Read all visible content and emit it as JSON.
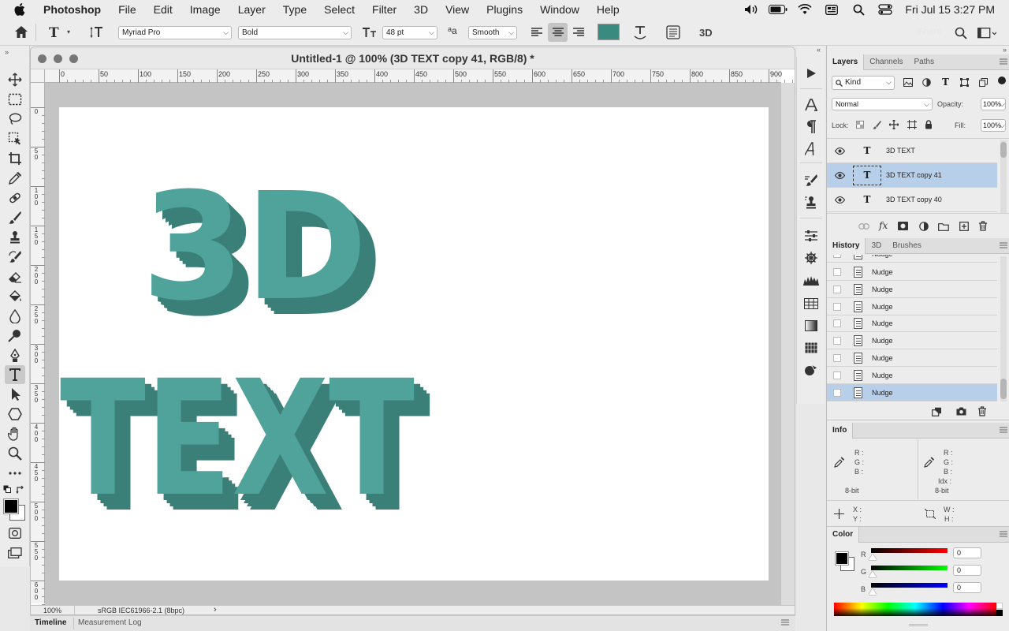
{
  "menubar": {
    "app": "Photoshop",
    "items": [
      "File",
      "Edit",
      "Image",
      "Layer",
      "Type",
      "Select",
      "Filter",
      "3D",
      "View",
      "Plugins",
      "Window",
      "Help"
    ],
    "clock": "Fri Jul 15  3:27 PM"
  },
  "options": {
    "font_family": "Myriad Pro",
    "font_style": "Bold",
    "font_size": "48 pt",
    "aa_label": "a",
    "antialias": "Smooth",
    "color_swatch": "#3b8a80",
    "mode_3d": "3D",
    "share_label": "Share"
  },
  "document": {
    "title": "Untitled-1 @ 100% (3D TEXT copy 41, RGB/8) *",
    "zoom": "100%",
    "profile": "sRGB IEC61966-2.1 (8bpc)",
    "ruler_labels": [
      "0",
      "50",
      "100",
      "150",
      "200",
      "250",
      "300",
      "350",
      "400",
      "450",
      "500",
      "550",
      "600",
      "650",
      "700",
      "750",
      "800",
      "850",
      "900"
    ],
    "vruler_labels": [
      "0",
      "50",
      "100",
      "150",
      "200",
      "250",
      "300",
      "350",
      "400",
      "450",
      "500",
      "550",
      "600"
    ],
    "canvas_line1": "3D",
    "canvas_line2": "TEXT",
    "text_face_color": "#4fa39a",
    "text_side_color": "#3a8078"
  },
  "bottom_tabs": [
    "Timeline",
    "Measurement Log"
  ],
  "layers_panel": {
    "tabs": [
      "Layers",
      "Channels",
      "Paths"
    ],
    "kind": "Kind",
    "blend_mode": "Normal",
    "opacity_label": "Opacity:",
    "opacity": "100%",
    "lock_label": "Lock:",
    "fill_label": "Fill:",
    "fill": "100%",
    "layers": [
      {
        "name": "3D TEXT",
        "selected": false
      },
      {
        "name": "3D TEXT copy 41",
        "selected": true
      },
      {
        "name": "3D TEXT copy 40",
        "selected": false
      }
    ],
    "type_glyph": "T"
  },
  "history_panel": {
    "tabs": [
      "History",
      "3D",
      "Brushes"
    ],
    "items": [
      "Nudge",
      "Nudge",
      "Nudge",
      "Nudge",
      "Nudge",
      "Nudge",
      "Nudge",
      "Nudge",
      "Nudge"
    ]
  },
  "info_panel": {
    "title": "Info",
    "left": {
      "r": "R :",
      "g": "G :",
      "b": "B :",
      "bit": "8-bit"
    },
    "right": {
      "r": "R :",
      "g": "G :",
      "b": "B :",
      "idx": "Idx :",
      "bit": "8-bit"
    },
    "x": "X :",
    "y": "Y :",
    "w": "W :",
    "h": "H :"
  },
  "color_panel": {
    "title": "Color",
    "r_label": "R",
    "g_label": "G",
    "b_label": "B",
    "r": "0",
    "g": "0",
    "b": "0"
  }
}
